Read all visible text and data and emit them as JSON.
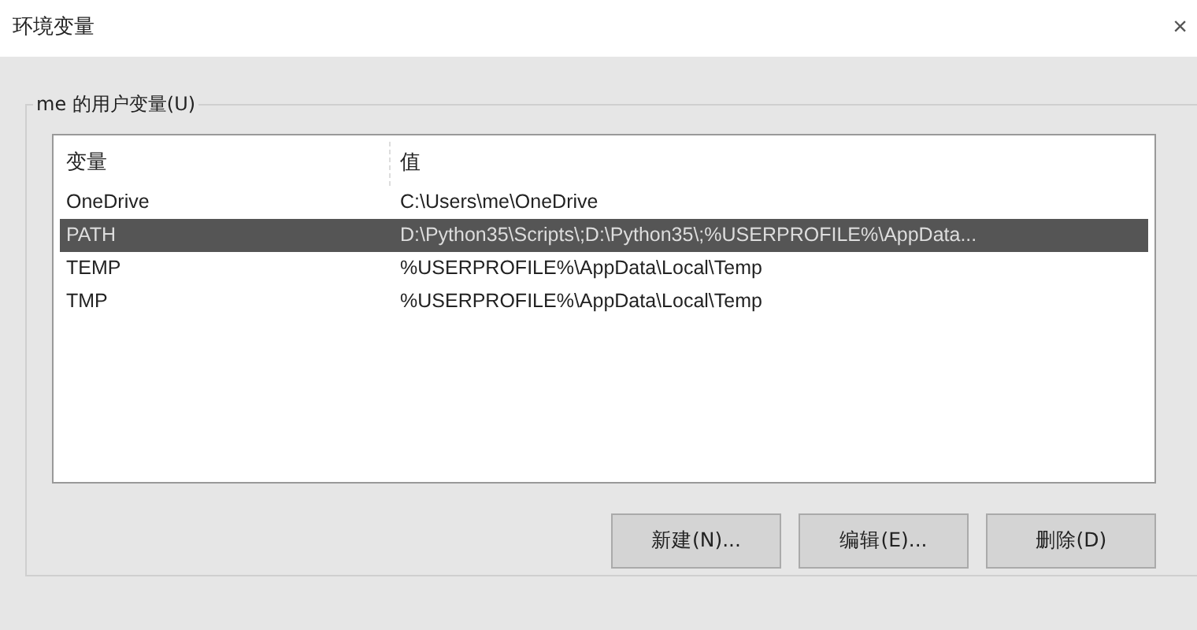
{
  "window": {
    "title": "环境变量",
    "close": "×"
  },
  "group": {
    "label": "me 的用户变量(U)"
  },
  "table": {
    "columns": [
      "变量",
      "值"
    ],
    "rows": [
      {
        "name": "OneDrive",
        "value": "C:\\Users\\me\\OneDrive",
        "selected": false
      },
      {
        "name": "PATH",
        "value": "D:\\Python35\\Scripts\\;D:\\Python35\\;%USERPROFILE%\\AppData...",
        "selected": true
      },
      {
        "name": "TEMP",
        "value": "%USERPROFILE%\\AppData\\Local\\Temp",
        "selected": false
      },
      {
        "name": "TMP",
        "value": "%USERPROFILE%\\AppData\\Local\\Temp",
        "selected": false
      }
    ]
  },
  "buttons": [
    "新建(N)...",
    "编辑(E)...",
    "删除(D)"
  ]
}
